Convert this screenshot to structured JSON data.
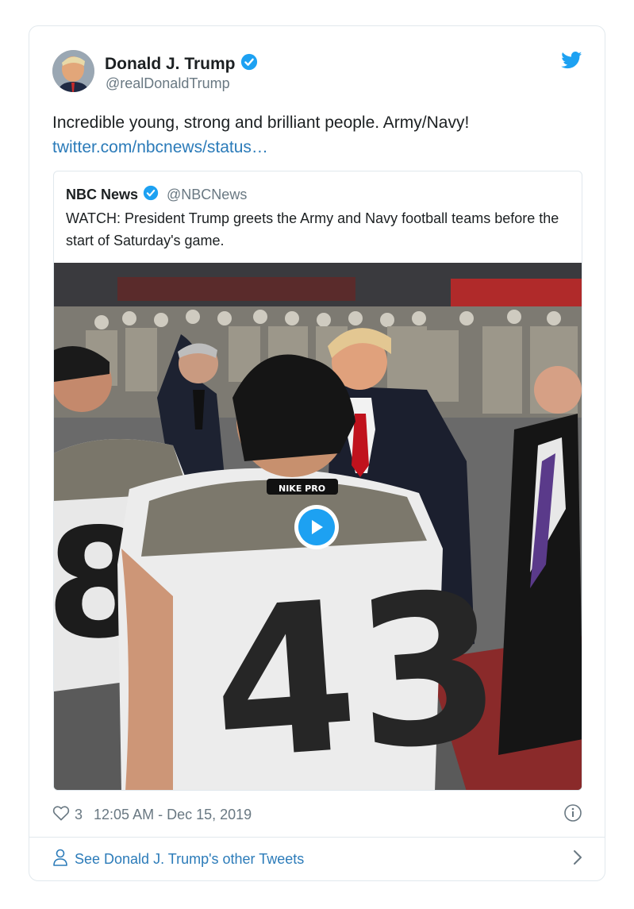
{
  "author": {
    "name": "Donald J. Trump",
    "handle": "@realDonaldTrump",
    "verified": true
  },
  "tweet": {
    "text": "Incredible young, strong and brilliant people. Army/Navy!",
    "link": "twitter.com/nbcnews/status…"
  },
  "quoted_tweet": {
    "name": "NBC News",
    "handle": "@NBCNews",
    "verified": true,
    "text": "WATCH: President Trump greets the Army and Navy football teams before the start of Saturday's game."
  },
  "media": {
    "jersey_numbers": [
      "43",
      "8"
    ],
    "collar_text": "NIKE PRO"
  },
  "meta": {
    "like_count": "3",
    "timestamp": "12:05 AM - Dec 15, 2019"
  },
  "footer": {
    "label": "See Donald J. Trump's other Tweets"
  },
  "colors": {
    "accent": "#1da1f2",
    "link": "#2b7bb9",
    "text": "#1c2022",
    "muted": "#697882",
    "border": "#e1e8ed"
  },
  "icons": [
    "verified-badge-icon",
    "twitter-bird-icon",
    "heart-icon",
    "info-icon",
    "person-icon",
    "chevron-right-icon",
    "play-icon"
  ]
}
